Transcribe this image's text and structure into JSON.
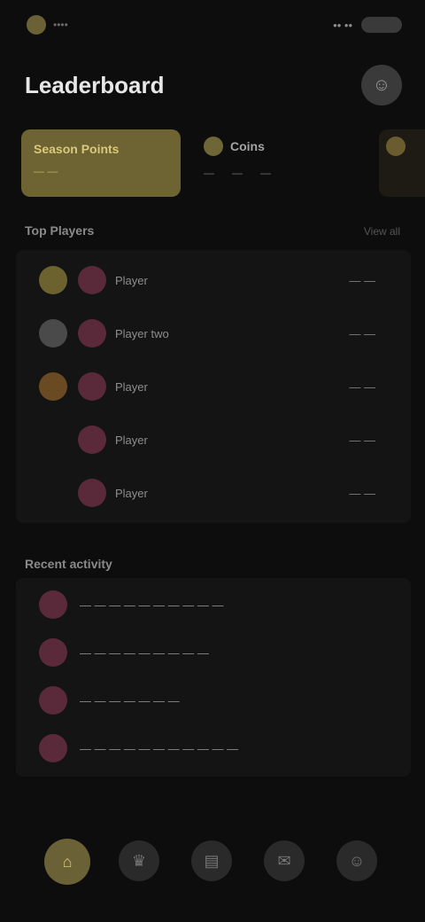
{
  "status": {
    "app_name": "••••",
    "time": "•• ••"
  },
  "header": {
    "title": "Leaderboard",
    "avatar_icon": "person-icon"
  },
  "cards": {
    "primary": {
      "title": "Season Points",
      "value": "— —"
    },
    "secondary": {
      "title": "Coins",
      "stat_a": "—",
      "stat_b": "—",
      "stat_c": "—"
    }
  },
  "rankings": {
    "label": "Top Players",
    "link": "View all",
    "rows": [
      {
        "medal_color": "#6b6230",
        "name": "Player",
        "score": "— —"
      },
      {
        "medal_color": "#4a4a4a",
        "name": "Player two",
        "score": "— —"
      },
      {
        "medal_color": "#6a4a22",
        "name": "Player",
        "score": "— —"
      },
      {
        "medal_color": "",
        "name": "Player",
        "score": "— —"
      },
      {
        "medal_color": "",
        "name": "Player",
        "score": "— —"
      }
    ]
  },
  "activity": {
    "label": "Recent activity",
    "rows": [
      {
        "text": "— — — — — — — — — —"
      },
      {
        "text": "— — — — — — — — —"
      },
      {
        "text": "— — — — — — —"
      },
      {
        "text": "— — — — — — — — — — —"
      }
    ]
  },
  "nav": {
    "items": [
      {
        "name": "home",
        "icon": "home-icon",
        "glyph": "⌂"
      },
      {
        "name": "trophy",
        "icon": "trophy-icon",
        "glyph": "♛"
      },
      {
        "name": "chart",
        "icon": "chart-icon",
        "glyph": "▤"
      },
      {
        "name": "chat",
        "icon": "chat-icon",
        "glyph": "✉"
      },
      {
        "name": "profile",
        "icon": "profile-icon",
        "glyph": "☺"
      }
    ]
  }
}
